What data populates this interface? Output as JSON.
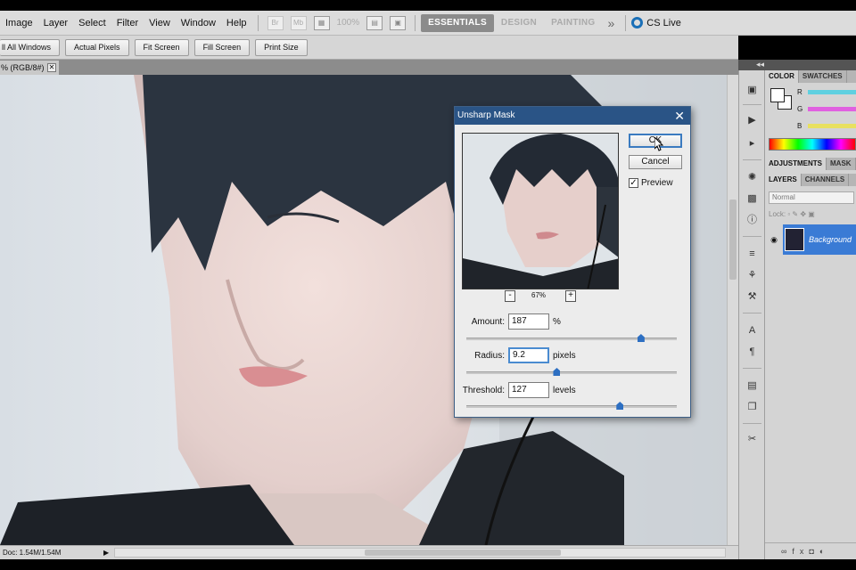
{
  "menu": {
    "items": [
      "Image",
      "Layer",
      "Select",
      "Filter",
      "View",
      "Window",
      "Help"
    ],
    "zoom": "100%",
    "workspaces": [
      "ESSENTIALS",
      "DESIGN",
      "PAINTING"
    ],
    "more": "»",
    "cslive": "CS Live"
  },
  "options": {
    "buttons": [
      "ll All Windows",
      "Actual Pixels",
      "Fit Screen",
      "Fill Screen",
      "Print Size"
    ]
  },
  "document": {
    "tab_label": "% (RGB/8#)",
    "close": "✕",
    "status": "Doc: 1.54M/1.54M",
    "status_arrow": "▶"
  },
  "panels": {
    "color_tabs": [
      "COLOR",
      "SWATCHES"
    ],
    "channels": [
      {
        "label": "R",
        "color": "#5fd0e0"
      },
      {
        "label": "G",
        "color": "#e060e0"
      },
      {
        "label": "B",
        "color": "#e8e060"
      }
    ],
    "adjust_tabs": [
      "ADJUSTMENTS",
      "MASK"
    ],
    "layer_tabs": [
      "LAYERS",
      "CHANNELS"
    ],
    "blend_mode": "Normal",
    "lock_label": "Lock:",
    "layer_name": "Background"
  },
  "dialog": {
    "title": "Unsharp Mask",
    "ok": "OK",
    "cancel": "Cancel",
    "preview_label": "Preview",
    "preview_checked": true,
    "zoom": "67%",
    "zoom_out": "-",
    "zoom_in": "+",
    "fields": [
      {
        "label": "Amount:",
        "value": "187",
        "unit": "%"
      },
      {
        "label": "Radius:",
        "value": "9.2",
        "unit": "pixels"
      },
      {
        "label": "Threshold:",
        "value": "127",
        "unit": "levels"
      }
    ],
    "slider_levels": [
      0.83,
      0.43,
      0.73
    ]
  }
}
